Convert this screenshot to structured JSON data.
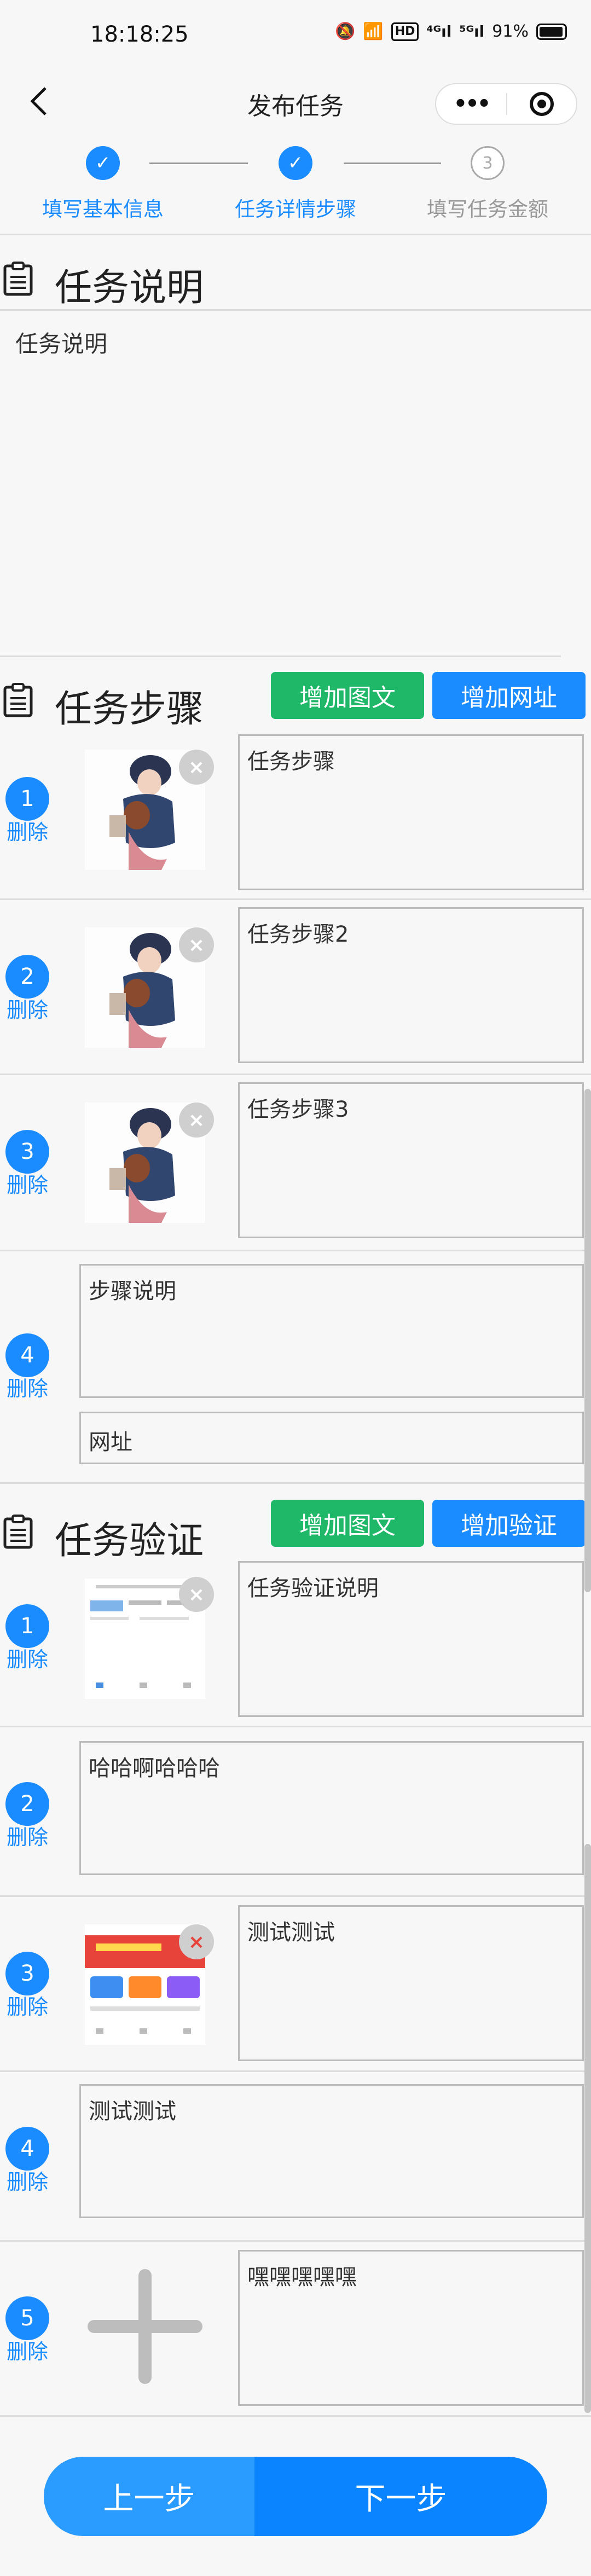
{
  "status": {
    "time": "18:18:25",
    "battery": "91%"
  },
  "nav": {
    "title": "发布任务"
  },
  "stepper": [
    {
      "label": "填写基本信息",
      "state": "done",
      "mark": "✓"
    },
    {
      "label": "任务详情步骤",
      "state": "done",
      "mark": "✓"
    },
    {
      "label": "填写任务金额",
      "state": "todo",
      "mark": "3"
    }
  ],
  "description": {
    "heading": "任务说明",
    "text": "任务说明"
  },
  "steps": {
    "heading": "任务步骤",
    "add_media_label": "增加图文",
    "add_url_label": "增加网址",
    "delete_label": "删除",
    "items": [
      {
        "num": "1",
        "text": "任务步骤"
      },
      {
        "num": "2",
        "text": "任务步骤2"
      },
      {
        "num": "3",
        "text": "任务步骤3"
      },
      {
        "num": "4",
        "text": "步骤说明",
        "url_placeholder": "网址"
      }
    ]
  },
  "verify": {
    "heading": "任务验证",
    "add_media_label": "增加图文",
    "add_verify_label": "增加验证",
    "delete_label": "删除",
    "items": [
      {
        "num": "1",
        "text": "任务验证说明"
      },
      {
        "num": "2",
        "text": "哈哈啊哈哈哈"
      },
      {
        "num": "3",
        "text": "测试测试"
      },
      {
        "num": "4",
        "text": "测试测试"
      },
      {
        "num": "5",
        "text": "嘿嘿嘿嘿嘿"
      }
    ]
  },
  "footer": {
    "prev_label": "上一步",
    "next_label": "下一步"
  },
  "colors": {
    "primary": "#1a8cff",
    "green": "#1fb868",
    "border": "#dddddd"
  }
}
